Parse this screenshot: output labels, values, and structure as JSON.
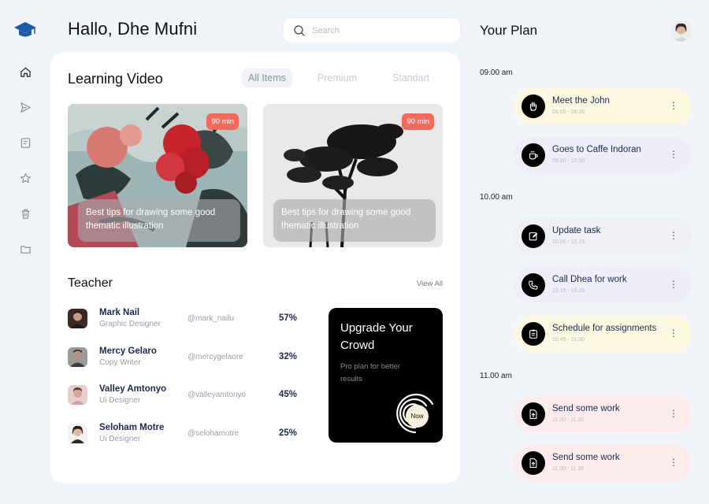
{
  "header": {
    "greeting": "Hallo, Dhe Mufni",
    "search_placeholder": "Search"
  },
  "sidebar": {
    "items": [
      {
        "icon": "home-icon",
        "label": "Home"
      },
      {
        "icon": "send-icon",
        "label": "Send"
      },
      {
        "icon": "notes-icon",
        "label": "Notes"
      },
      {
        "icon": "star-icon",
        "label": "Favorites"
      },
      {
        "icon": "trash-icon",
        "label": "Trash"
      },
      {
        "icon": "folder-icon",
        "label": "Folder"
      }
    ]
  },
  "learning": {
    "title": "Learning Video",
    "tabs": [
      "All Items",
      "Premium",
      "Standart"
    ],
    "active_tab": "All Items",
    "videos": [
      {
        "duration": "90 min",
        "caption": "Best tips for drawing some good thematic illustration"
      },
      {
        "duration": "90 min",
        "caption": "Best tips for drawing some good thematic illustration"
      }
    ]
  },
  "teachers": {
    "title": "Teacher",
    "view_all": "View All",
    "rows": [
      {
        "name": "Mark Nail",
        "role": "Graphic Designer",
        "handle": "@mark_nailu",
        "percent": "57%"
      },
      {
        "name": "Mercy Gelaro",
        "role": "Copy Writer",
        "handle": "@mercygelaore",
        "percent": "32%"
      },
      {
        "name": "Valley Amtonyo",
        "role": "Ui Designer",
        "handle": "@valleyamtonyo",
        "percent": "45%"
      },
      {
        "name": "Seloham Motre",
        "role": "Ui Designer",
        "handle": "@selohamotre",
        "percent": "25%"
      }
    ]
  },
  "upgrade": {
    "title": "Upgrade Your Crowd",
    "subtitle": "Pro plan for better results",
    "button": "Now"
  },
  "plan": {
    "title": "Your Plan",
    "groups": [
      {
        "time": "09.00 am",
        "items": [
          {
            "title": "Meet the John",
            "time": "09.00 - 09.30",
            "icon": "hand-icon",
            "color": "#fcf8e1"
          },
          {
            "title": "Goes to Caffe Indoran",
            "time": "09.30 - 10.00",
            "icon": "coffee-icon",
            "color": "#efedf7"
          }
        ]
      },
      {
        "time": "10.00 am",
        "items": [
          {
            "title": "Update task",
            "time": "10.00 - 10.15",
            "icon": "edit-icon",
            "color": "#eef0f3"
          },
          {
            "title": "Call Dhea for work",
            "time": "10.15 - 10.45",
            "icon": "phone-icon",
            "color": "#efedf7"
          },
          {
            "title": "Schedule for assignments",
            "time": "10.45 - 11.00",
            "icon": "clipboard-icon",
            "color": "#fcf8e1"
          }
        ]
      },
      {
        "time": "11.00 am",
        "items": [
          {
            "title": "Send some work",
            "time": "11.00 - 11.30",
            "icon": "document-upload-icon",
            "color": "#fdeceb"
          },
          {
            "title": "Send some work",
            "time": "11.00 - 11.30",
            "icon": "document-upload-icon",
            "color": "#fdeceb"
          }
        ]
      }
    ]
  },
  "colors": {
    "accent_orange": "#f26a5d",
    "navy_text": "#1d2a4f",
    "logo_blue": "#1e5aa8"
  }
}
